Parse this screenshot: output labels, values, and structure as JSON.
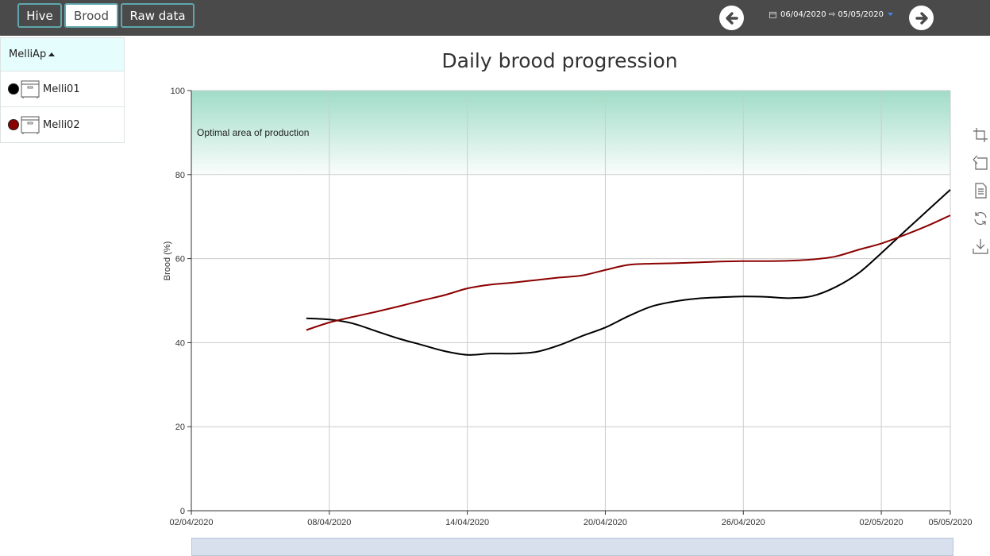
{
  "tabs": [
    {
      "label": "Hive",
      "active": false
    },
    {
      "label": "Brood",
      "active": true
    },
    {
      "label": "Raw data",
      "active": false
    }
  ],
  "date_range": "06/04/2020 ⇨ 05/05/2020",
  "sidebar": {
    "header": "MelliAp",
    "hives": [
      {
        "name": "Melli01",
        "color": "#000000"
      },
      {
        "name": "Melli02",
        "color": "#8b0000"
      }
    ]
  },
  "colors": {
    "topbar": "#4a4a4a",
    "accent": "#5fa7ad",
    "optimal_band": "#8fd6bd"
  },
  "chart_data": {
    "type": "line",
    "title": "Daily brood progression",
    "ylabel": "Brood (%)",
    "xlabel": "",
    "ylim": [
      0,
      100
    ],
    "yticks": [
      0,
      20,
      40,
      60,
      80,
      100
    ],
    "x_range": [
      "2020-04-02",
      "2020-05-05"
    ],
    "x_ticks": [
      "02/04/2020",
      "08/04/2020",
      "14/04/2020",
      "20/04/2020",
      "26/04/2020",
      "02/05/2020",
      "05/05/2020"
    ],
    "x_tick_dates": [
      "2020-04-02",
      "2020-04-08",
      "2020-04-14",
      "2020-04-20",
      "2020-04-26",
      "2020-05-02",
      "2020-05-05"
    ],
    "grid": true,
    "band": {
      "from": 80,
      "to": 100,
      "label": "Optimal area of production"
    },
    "series": [
      {
        "name": "Melli01",
        "color": "#000000",
        "x": [
          "2020-04-07",
          "2020-04-08",
          "2020-04-09",
          "2020-04-10",
          "2020-04-11",
          "2020-04-12",
          "2020-04-13",
          "2020-04-14",
          "2020-04-15",
          "2020-04-16",
          "2020-04-17",
          "2020-04-18",
          "2020-04-19",
          "2020-04-20",
          "2020-04-21",
          "2020-04-22",
          "2020-04-23",
          "2020-04-24",
          "2020-04-25",
          "2020-04-26",
          "2020-04-27",
          "2020-04-28",
          "2020-04-29",
          "2020-04-30",
          "2020-05-01",
          "2020-05-02",
          "2020-05-03",
          "2020-05-04",
          "2020-05-05"
        ],
        "y": [
          45.8,
          45.5,
          44.6,
          42.8,
          41.0,
          39.5,
          38.0,
          37.1,
          37.4,
          37.4,
          37.8,
          39.4,
          41.6,
          43.6,
          46.3,
          48.6,
          49.8,
          50.5,
          50.8,
          51.0,
          50.9,
          50.6,
          51.1,
          53.2,
          56.5,
          61.3,
          66.4,
          71.4,
          76.4
        ]
      },
      {
        "name": "Melli02",
        "color": "#8b0000",
        "x": [
          "2020-04-07",
          "2020-04-08",
          "2020-04-09",
          "2020-04-10",
          "2020-04-11",
          "2020-04-12",
          "2020-04-13",
          "2020-04-14",
          "2020-04-15",
          "2020-04-16",
          "2020-04-17",
          "2020-04-18",
          "2020-04-19",
          "2020-04-20",
          "2020-04-21",
          "2020-04-22",
          "2020-04-23",
          "2020-04-24",
          "2020-04-25",
          "2020-04-26",
          "2020-04-27",
          "2020-04-28",
          "2020-04-29",
          "2020-04-30",
          "2020-05-01",
          "2020-05-02",
          "2020-05-03",
          "2020-05-04",
          "2020-05-05"
        ],
        "y": [
          43.0,
          44.8,
          46.1,
          47.3,
          48.6,
          50.0,
          51.3,
          52.9,
          53.8,
          54.3,
          54.9,
          55.5,
          56.0,
          57.3,
          58.5,
          58.8,
          58.9,
          59.1,
          59.3,
          59.4,
          59.4,
          59.5,
          59.8,
          60.5,
          62.1,
          63.6,
          65.6,
          67.8,
          70.3
        ]
      }
    ]
  }
}
